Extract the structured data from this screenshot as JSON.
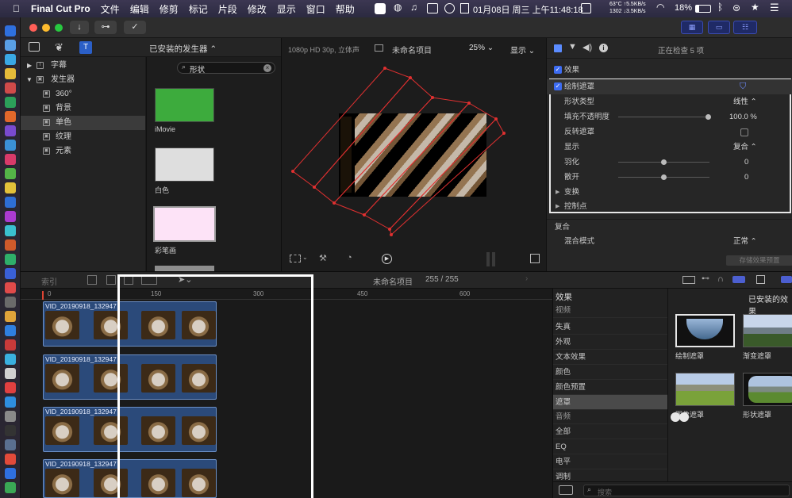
{
  "menubar": {
    "app": "Final Cut Pro",
    "items": [
      "文件",
      "编辑",
      "修剪",
      "标记",
      "片段",
      "修改",
      "显示",
      "窗口",
      "帮助"
    ],
    "datetime": "01月08日 周三 上午11:48:18",
    "net_up": "63°C ↑5.5KB/s",
    "net_down": "1302 ↓3.5KB/s",
    "battery": "18%"
  },
  "libraries": {
    "header": "已安装的发生器 ⌃",
    "search_value": "形状",
    "tree": [
      {
        "label": "字幕",
        "level": 0,
        "expanded": false
      },
      {
        "label": "发生器",
        "level": 0,
        "expanded": true
      },
      {
        "label": "360°",
        "level": 1
      },
      {
        "label": "背景",
        "level": 1
      },
      {
        "label": "单色",
        "level": 1,
        "selected": true
      },
      {
        "label": "纹理",
        "level": 1
      },
      {
        "label": "元素",
        "level": 1
      }
    ],
    "generators": [
      {
        "label": "iMovie",
        "color": "#3dab3d"
      },
      {
        "label": "白色",
        "color": "#dedede"
      },
      {
        "label": "彩笔画",
        "color": "#fde3f7"
      }
    ]
  },
  "viewer": {
    "format": "1080p HD 30p, 立体声",
    "project": "未命名项目",
    "zoom": "25% ⌄",
    "display": "显示 ⌄"
  },
  "inspector": {
    "status": "正在检查 5 项",
    "section_effects": "效果",
    "draw_mask": "绘制遮罩",
    "rows": [
      {
        "key": "形状类型",
        "value": "线性 ⌃"
      },
      {
        "key": "填充不透明度",
        "value": "100.0  %"
      },
      {
        "key": "反转遮罩",
        "value": ""
      },
      {
        "key": "显示",
        "value": "复合 ⌃"
      },
      {
        "key": "羽化",
        "value": "0"
      },
      {
        "key": "散开",
        "value": "0"
      },
      {
        "key": "变换",
        "value": ""
      },
      {
        "key": "控制点",
        "value": ""
      }
    ],
    "composite": "复合",
    "blend_mode_label": "混合模式",
    "blend_mode_value": "正常 ⌃",
    "save_preset": "存储效果预置"
  },
  "timeline": {
    "index": "索引",
    "project": "未命名项目",
    "duration": "255 / 255",
    "ruler": [
      "0",
      "150",
      "300",
      "450",
      "600"
    ],
    "clips": [
      "VID_20190918_132947",
      "VID_20190918_132947",
      "VID_20190918_132947",
      "VID_20190918_132947"
    ]
  },
  "effects_browser": {
    "header": "效果",
    "title": "已安装的效果",
    "categories": [
      "视频",
      "失真",
      "外观",
      "文本效果",
      "颜色",
      "颜色预置",
      "遮罩",
      "音频",
      "全部",
      "EQ",
      "电平",
      "调制"
    ],
    "selected": "遮罩",
    "tiles": [
      "绘制遮罩",
      "渐变遮罩",
      "图像遮罩",
      "形状遮罩"
    ],
    "search_placeholder": "搜索"
  }
}
